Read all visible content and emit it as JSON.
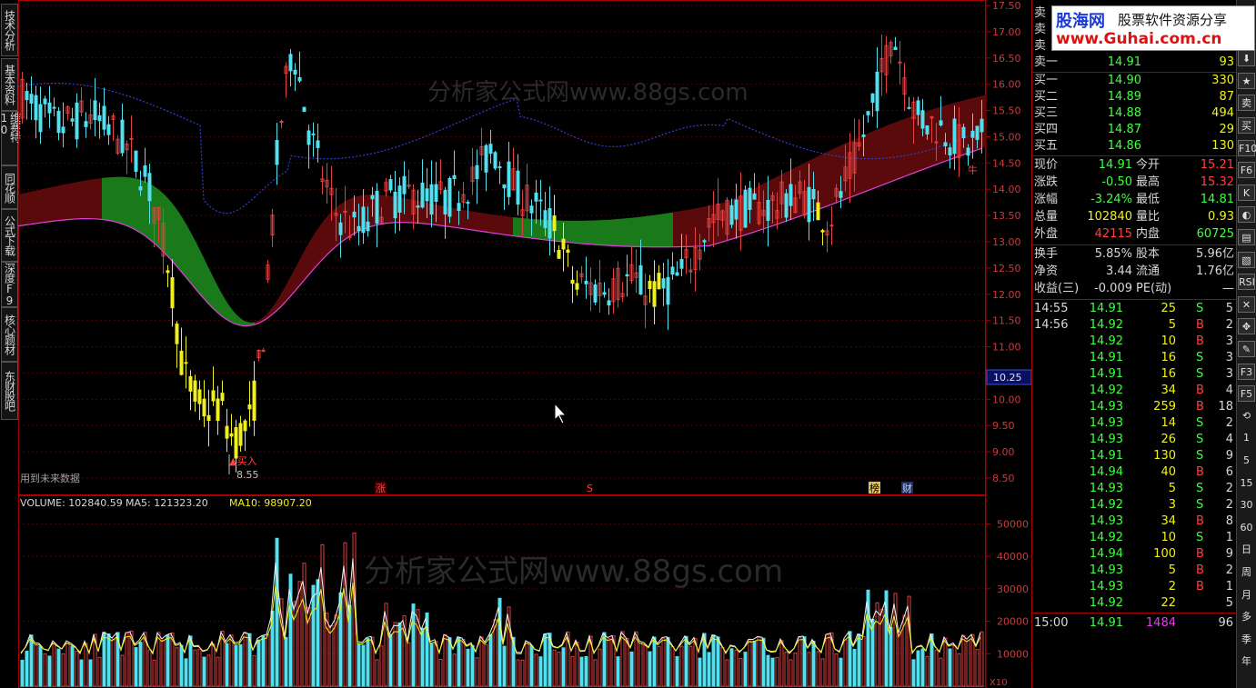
{
  "left_tabs": [
    "技术分析",
    "基本资料",
    "维赛特10",
    "同花顺",
    "公式下载",
    "深度F9",
    "核心题材",
    "东财股吧"
  ],
  "chart": {
    "watermark": "分析家公式网www.88gs.com",
    "future_data_note": "用到未来数据",
    "buy_label": "▲买入",
    "low_label": "8.55",
    "bull_label": "牛",
    "current_price_tag": "10.25",
    "price_axis": [
      "17.50",
      "17.00",
      "16.50",
      "16.00",
      "15.50",
      "15.00",
      "14.50",
      "14.00",
      "13.50",
      "13.00",
      "12.50",
      "12.00",
      "11.50",
      "11.00",
      "10.50",
      "10.00",
      "9.50",
      "9.00",
      "8.50"
    ],
    "markers": [
      {
        "text": "涨",
        "color": "#ff4040",
        "bg": "#400000"
      },
      {
        "text": "S",
        "color": "#ff4040",
        "bg": "#000"
      },
      {
        "text": "榜",
        "color": "#000",
        "bg": "#e0c060"
      },
      {
        "text": "财",
        "color": "#c0d0ff",
        "bg": "#203060"
      }
    ],
    "volume": {
      "title": "VOLUME: 102840.59",
      "ma5": "MA5: 121323.20",
      "ma10": "MA10: 98907.20",
      "axis": [
        "50000",
        "40000",
        "30000",
        "20000",
        "10000"
      ],
      "unit": "X10"
    },
    "colors": {
      "up": "#e04040",
      "down": "#50e0f0",
      "ma_blue": "#3040d0",
      "green_band": "#1a7a1a",
      "red_band": "#5a0a0a",
      "yellow": "#f0f020",
      "magenta": "#e040e0"
    }
  },
  "order_book": {
    "sells": [
      {
        "label": "卖",
        "price": "",
        "vol": ""
      },
      {
        "label": "卖",
        "price": "",
        "vol": ""
      },
      {
        "label": "卖",
        "price": "",
        "vol": ""
      },
      {
        "label": "卖一",
        "price": "14.91",
        "vol": "93"
      }
    ],
    "buys": [
      {
        "label": "买一",
        "price": "14.90",
        "vol": "330"
      },
      {
        "label": "买二",
        "price": "14.89",
        "vol": "87"
      },
      {
        "label": "买三",
        "price": "14.88",
        "vol": "494"
      },
      {
        "label": "买四",
        "price": "14.87",
        "vol": "29"
      },
      {
        "label": "买五",
        "price": "14.86",
        "vol": "130"
      }
    ]
  },
  "stats": [
    {
      "l1": "现价",
      "v1": "14.91",
      "c1": "#40ff40",
      "l2": "今开",
      "v2": "15.21",
      "c2": "#ff4040"
    },
    {
      "l1": "涨跌",
      "v1": "-0.50",
      "c1": "#40ff40",
      "l2": "最高",
      "v2": "15.32",
      "c2": "#ff4040"
    },
    {
      "l1": "涨幅",
      "v1": "-3.24%",
      "c1": "#40ff40",
      "l2": "最低",
      "v2": "14.81",
      "c2": "#40ff40"
    },
    {
      "l1": "总量",
      "v1": "102840",
      "c1": "#f0f020",
      "l2": "量比",
      "v2": "0.93",
      "c2": "#f0f020"
    },
    {
      "l1": "外盘",
      "v1": "42115",
      "c1": "#ff4040",
      "l2": "内盘",
      "v2": "60725",
      "c2": "#40ff40"
    }
  ],
  "stats2": [
    {
      "l1": "换手",
      "v1": "5.85%",
      "c1": "#d8d8d8",
      "l2": "股本",
      "v2": "5.96亿",
      "c2": "#d8d8d8"
    },
    {
      "l1": "净资",
      "v1": "3.44",
      "c1": "#d8d8d8",
      "l2": "流通",
      "v2": "1.76亿",
      "c2": "#d8d8d8"
    },
    {
      "l1": "收益(三)",
      "v1": "-0.009",
      "c1": "#d8d8d8",
      "l2": "PE(动)",
      "v2": "—",
      "c2": "#d8d8d8"
    }
  ],
  "ticks": [
    {
      "t": "14:55",
      "p": "14.91",
      "v": "25",
      "s": "S",
      "n": "5"
    },
    {
      "t": "14:56",
      "p": "14.92",
      "v": "5",
      "s": "B",
      "n": "2"
    },
    {
      "t": "",
      "p": "14.92",
      "v": "10",
      "s": "B",
      "n": "3"
    },
    {
      "t": "",
      "p": "14.91",
      "v": "16",
      "s": "S",
      "n": "3"
    },
    {
      "t": "",
      "p": "14.91",
      "v": "16",
      "s": "S",
      "n": "3"
    },
    {
      "t": "",
      "p": "14.92",
      "v": "34",
      "s": "B",
      "n": "4"
    },
    {
      "t": "",
      "p": "14.93",
      "v": "259",
      "s": "B",
      "n": "18"
    },
    {
      "t": "",
      "p": "14.93",
      "v": "14",
      "s": "S",
      "n": "2"
    },
    {
      "t": "",
      "p": "14.93",
      "v": "26",
      "s": "S",
      "n": "4"
    },
    {
      "t": "",
      "p": "14.91",
      "v": "130",
      "s": "S",
      "n": "9"
    },
    {
      "t": "",
      "p": "14.94",
      "v": "40",
      "s": "B",
      "n": "6"
    },
    {
      "t": "",
      "p": "14.93",
      "v": "5",
      "s": "S",
      "n": "2"
    },
    {
      "t": "",
      "p": "14.92",
      "v": "3",
      "s": "S",
      "n": "2"
    },
    {
      "t": "",
      "p": "14.93",
      "v": "34",
      "s": "B",
      "n": "8"
    },
    {
      "t": "",
      "p": "14.92",
      "v": "10",
      "s": "S",
      "n": "1"
    },
    {
      "t": "",
      "p": "14.94",
      "v": "100",
      "s": "B",
      "n": "9"
    },
    {
      "t": "",
      "p": "14.93",
      "v": "5",
      "s": "B",
      "n": "2"
    },
    {
      "t": "",
      "p": "14.93",
      "v": "2",
      "s": "B",
      "n": "1"
    },
    {
      "t": "",
      "p": "14.92",
      "v": "22",
      "s": "",
      "n": "5"
    }
  ],
  "close_row": {
    "t": "15:00",
    "p": "14.91",
    "v": "1484",
    "n": "96"
  },
  "toolbar": [
    "+",
    "⬆",
    "⬇",
    "★",
    "卖",
    "买",
    "F10",
    "F6",
    "K",
    "◐",
    "▤",
    "▧",
    "RSI",
    "✕",
    "✥",
    "✎",
    "F3",
    "F5",
    "⟲",
    "1",
    "5",
    "15",
    "30",
    "60",
    "日",
    "周",
    "月",
    "多",
    "季",
    "年"
  ],
  "ad": {
    "brand": "股海网",
    "slogan": "股票软件资源分享",
    "url": "www.Guhai.com.cn"
  }
}
